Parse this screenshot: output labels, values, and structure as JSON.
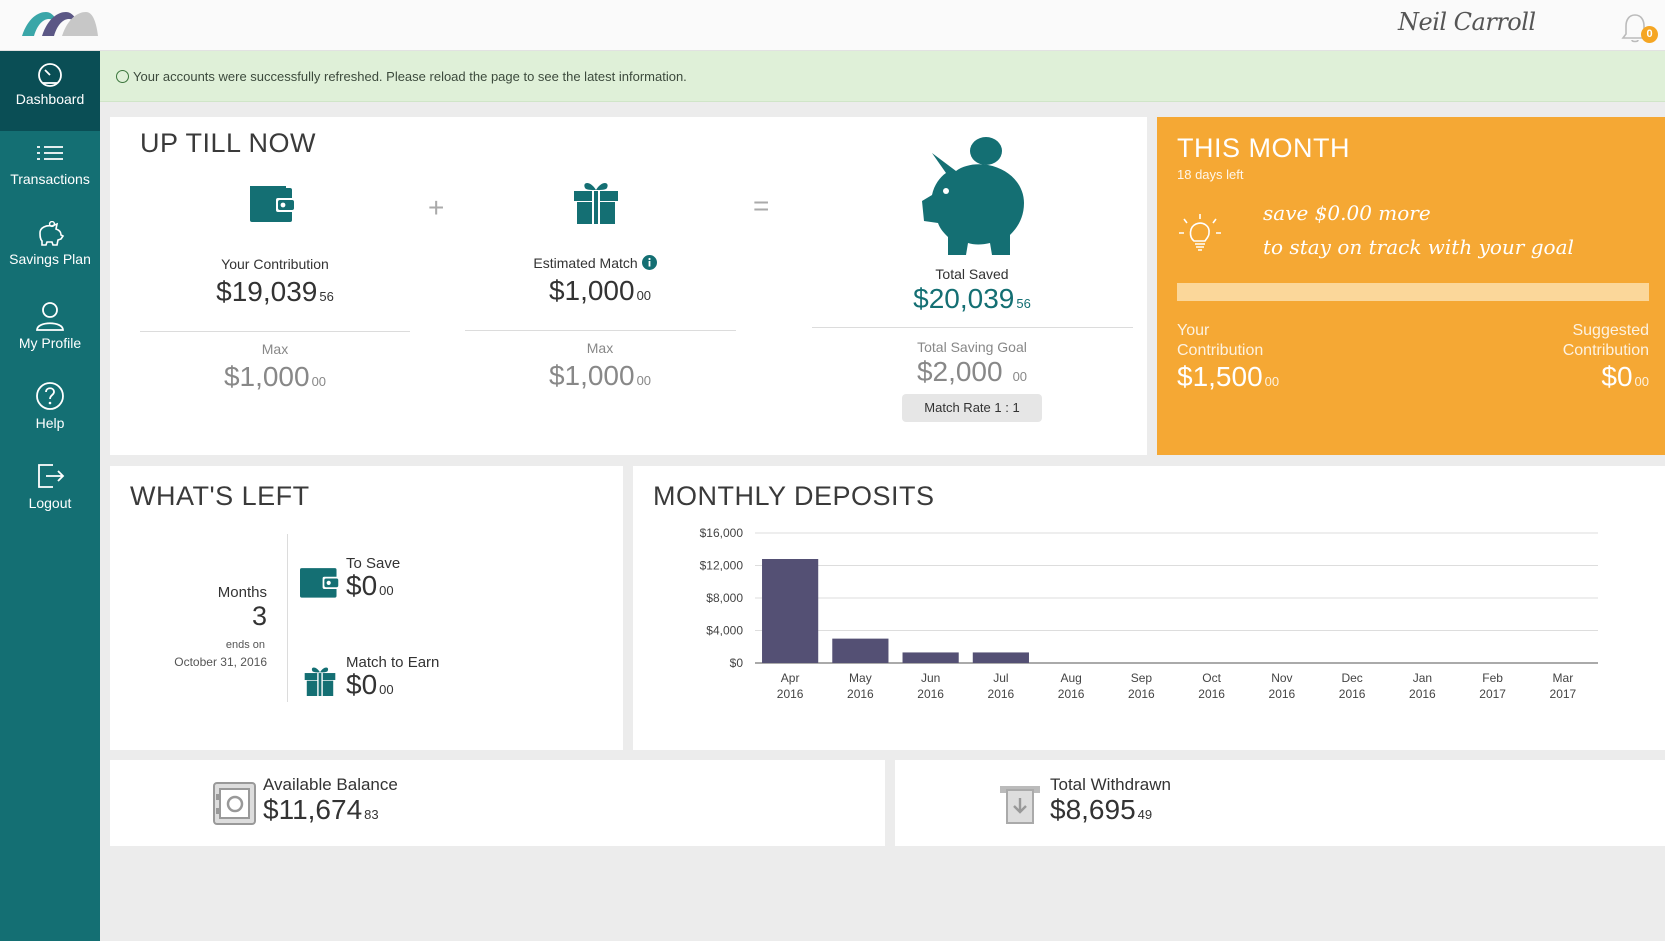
{
  "header": {
    "user_name": "Neil Carroll",
    "notification_count": "0"
  },
  "sidebar": {
    "items": [
      {
        "label": "Dashboard",
        "icon": "speedometer-icon"
      },
      {
        "label": "Transactions",
        "icon": "list-icon"
      },
      {
        "label": "Savings Plan",
        "icon": "piggy-bank-icon"
      },
      {
        "label": "My Profile",
        "icon": "user-icon"
      },
      {
        "label": "Help",
        "icon": "question-icon"
      },
      {
        "label": "Logout",
        "icon": "logout-icon"
      }
    ]
  },
  "alert": {
    "message": "Your accounts were successfully refreshed. Please reload the page to see the latest information."
  },
  "up_till_now": {
    "title": "UP TILL NOW",
    "contribution": {
      "label": "Your Contribution",
      "dollars": "$19,039",
      "cents": "56",
      "max_label": "Max",
      "max_dollars": "$1,000",
      "max_cents": "00"
    },
    "match": {
      "label": "Estimated Match",
      "dollars": "$1,000",
      "cents": "00",
      "max_label": "Max",
      "max_dollars": "$1,000",
      "max_cents": "00"
    },
    "total": {
      "label": "Total Saved",
      "dollars": "$20,039",
      "cents": "56",
      "goal_label": "Total Saving Goal",
      "goal_dollars": "$2,000",
      "goal_cents": "00",
      "match_rate": "Match Rate 1 : 1"
    },
    "plus": "+",
    "equals": "="
  },
  "this_month": {
    "title": "THIS MONTH",
    "days_left": "18 days left",
    "line1": "save $0.00 more",
    "line2": "to stay on track with your goal",
    "progress": 0,
    "your_label_1": "Your",
    "your_label_2": "Contribution",
    "your_dollars": "$1,500",
    "your_cents": "00",
    "suggested_label_1": "Suggested",
    "suggested_label_2": "Contribution",
    "suggested_dollars": "$0",
    "suggested_cents": "00"
  },
  "whats_left": {
    "title": "WHAT'S LEFT",
    "months_label": "Months",
    "months_value": "3",
    "ends_label": "ends on",
    "ends_date": "October 31, 2016",
    "to_save_label": "To Save",
    "to_save_dollars": "$0",
    "to_save_cents": "00",
    "match_label": "Match to Earn",
    "match_dollars": "$0",
    "match_cents": "00"
  },
  "monthly_deposits": {
    "title": "MONTHLY DEPOSITS"
  },
  "chart_data": {
    "type": "bar",
    "title": "MONTHLY DEPOSITS",
    "categories": [
      [
        "Apr",
        "2016"
      ],
      [
        "May",
        "2016"
      ],
      [
        "Jun",
        "2016"
      ],
      [
        "Jul",
        "2016"
      ],
      [
        "Aug",
        "2016"
      ],
      [
        "Sep",
        "2016"
      ],
      [
        "Oct",
        "2016"
      ],
      [
        "Nov",
        "2016"
      ],
      [
        "Dec",
        "2016"
      ],
      [
        "Jan",
        "2016"
      ],
      [
        "Feb",
        "2017"
      ],
      [
        "Mar",
        "2017"
      ]
    ],
    "values": [
      12800,
      3000,
      1300,
      1300,
      0,
      0,
      0,
      0,
      0,
      0,
      0,
      0
    ],
    "ylim": [
      0,
      16000
    ],
    "yticks": [
      "$0",
      "$4,000",
      "$8,000",
      "$12,000",
      "$16,000"
    ],
    "ytick_values": [
      0,
      4000,
      8000,
      12000,
      16000
    ],
    "grid": true,
    "bar_color": "#545074"
  },
  "balance": {
    "label": "Available Balance",
    "dollars": "$11,674",
    "cents": "83"
  },
  "withdrawn": {
    "label": "Total Withdrawn",
    "dollars": "$8,695",
    "cents": "49"
  }
}
